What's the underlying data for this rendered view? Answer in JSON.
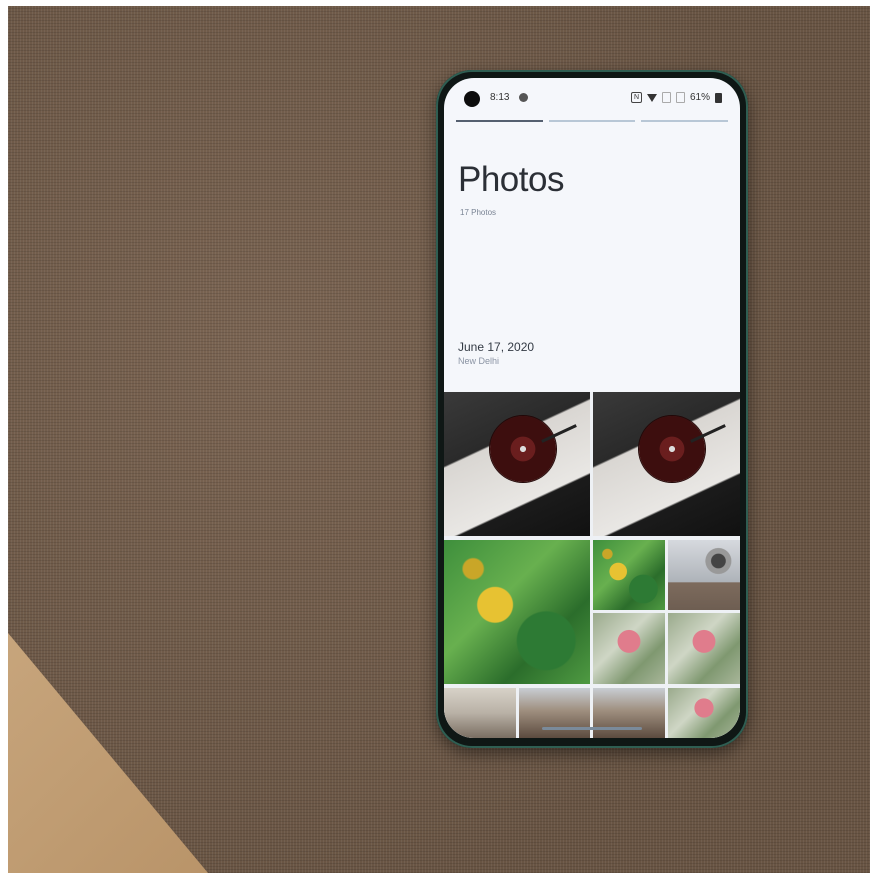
{
  "status_bar": {
    "time": "8:13",
    "battery": "61%",
    "nfc": "N"
  },
  "album": {
    "title": "Photos",
    "count": "17 Photos",
    "date": "June 17, 2020",
    "location": "New Delhi"
  },
  "colors": {
    "carpet": "#6e5a48",
    "phone_frame": "#2f5e52",
    "screen_bg": "#f5f7fb"
  }
}
